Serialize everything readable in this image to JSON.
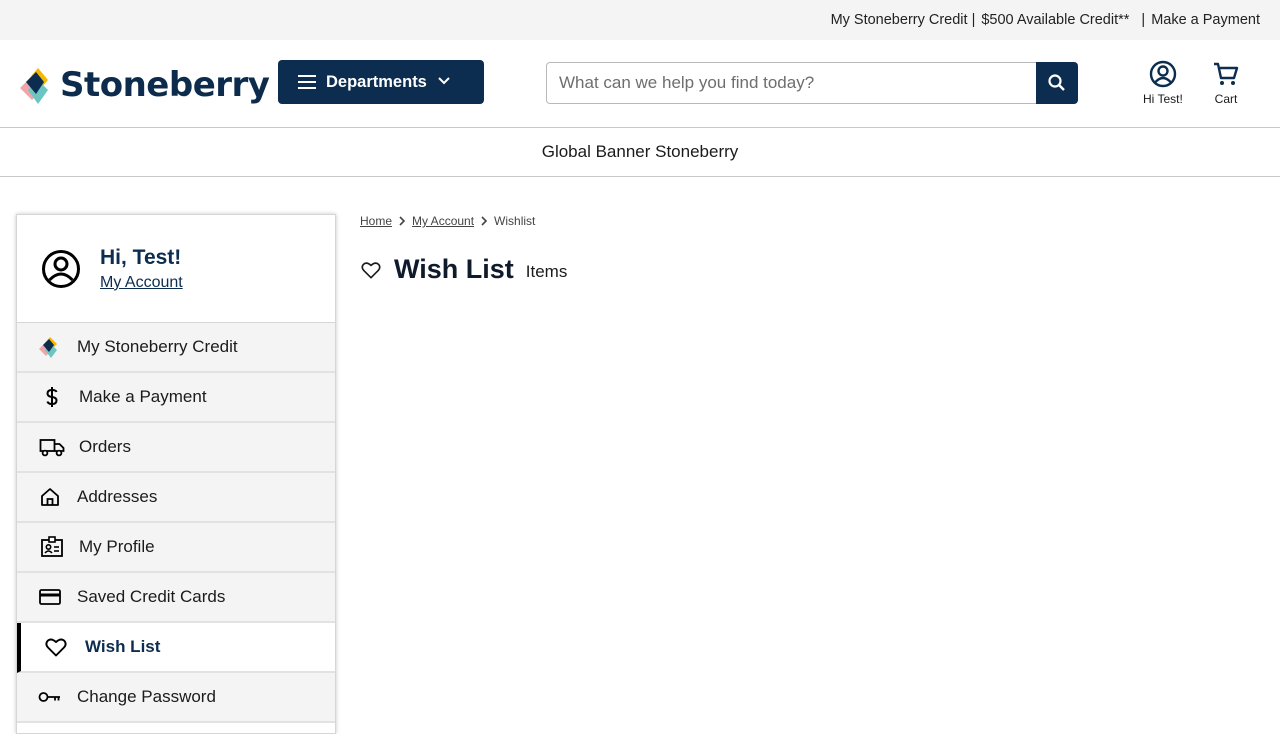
{
  "utility_bar": {
    "credit_link": "My Stoneberry Credit",
    "sep1": "|",
    "available_credit": "$500 Available Credit**",
    "sep2": "|",
    "payment_link": "Make a Payment"
  },
  "header": {
    "logo_text": "Stoneberry",
    "departments_label": "Departments",
    "search_placeholder": "What can we help you find today?",
    "account_label": "Hi Test!",
    "cart_label": "Cart"
  },
  "banner": {
    "text": "Global Banner Stoneberry"
  },
  "sidebar": {
    "greeting": "Hi, Test!",
    "account_link": "My Account",
    "items": [
      {
        "label": "My Stoneberry Credit",
        "icon": "stoneberry-logo-icon"
      },
      {
        "label": "Make a Payment",
        "icon": "dollar-icon"
      },
      {
        "label": "Orders",
        "icon": "truck-icon"
      },
      {
        "label": "Addresses",
        "icon": "home-icon"
      },
      {
        "label": "My Profile",
        "icon": "id-card-icon"
      },
      {
        "label": "Saved Credit Cards",
        "icon": "credit-card-icon"
      },
      {
        "label": "Wish List",
        "icon": "heart-icon",
        "active": true
      },
      {
        "label": "Change Password",
        "icon": "key-icon"
      }
    ]
  },
  "breadcrumb": [
    "Home",
    "My Account",
    "Wishlist"
  ],
  "page": {
    "title": "Wish List",
    "count_label": "Items"
  },
  "colors": {
    "brand_navy": "#0c2d4f",
    "util_bg": "#f4f4f4",
    "sidebar_item_bg": "#f4f4f4"
  }
}
